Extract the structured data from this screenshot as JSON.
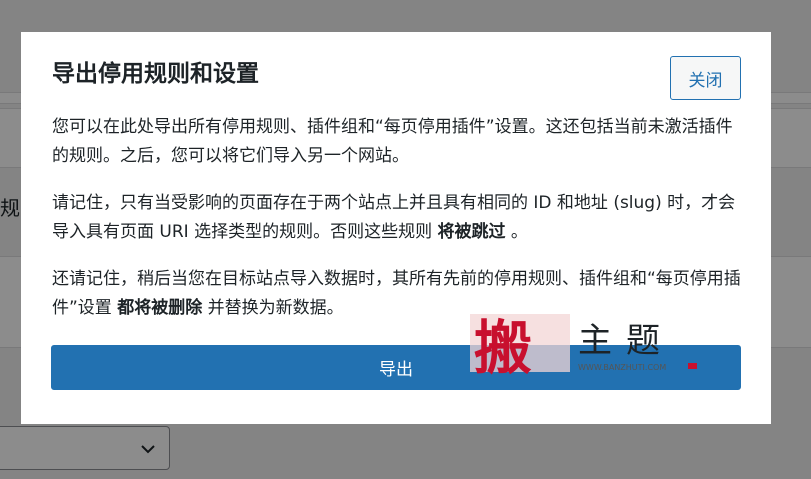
{
  "background": {
    "partial_label": "规",
    "select_chevron_icon": "chevron-down-icon"
  },
  "modal": {
    "title": "导出停用规则和设置",
    "close_label": "关闭",
    "paragraphs": {
      "p1": "您可以在此处导出所有停用规则、插件组和“每页停用插件”设置。这还包括当前未激活插件的规则。之后，您可以将它们导入另一个网站。",
      "p2_before": "请记住，只有当受影响的页面存在于两个站点上并且具有相同的 ID 和地址 (slug) 时，才会导入具有页面 URI 选择类型的规则。否则这些规则 ",
      "p2_strong": "将被跳过",
      "p2_after": " 。",
      "p3_before": "还请记住，稍后当您在目标站点导入数据时，其所有先前的停用规则、插件组和“每页停用插件”设置 ",
      "p3_strong": "都将被删除",
      "p3_after": " 并替换为新数据。"
    },
    "export_label": "导出"
  },
  "watermark": {
    "glyph": "搬",
    "text": "主题",
    "url": "WWW.BANZHUTI.COM"
  },
  "colors": {
    "primary": "#2271b1",
    "text": "#1d2327",
    "overlay": "rgba(0,0,0,0.45)",
    "watermark_red": "#c8102e"
  }
}
